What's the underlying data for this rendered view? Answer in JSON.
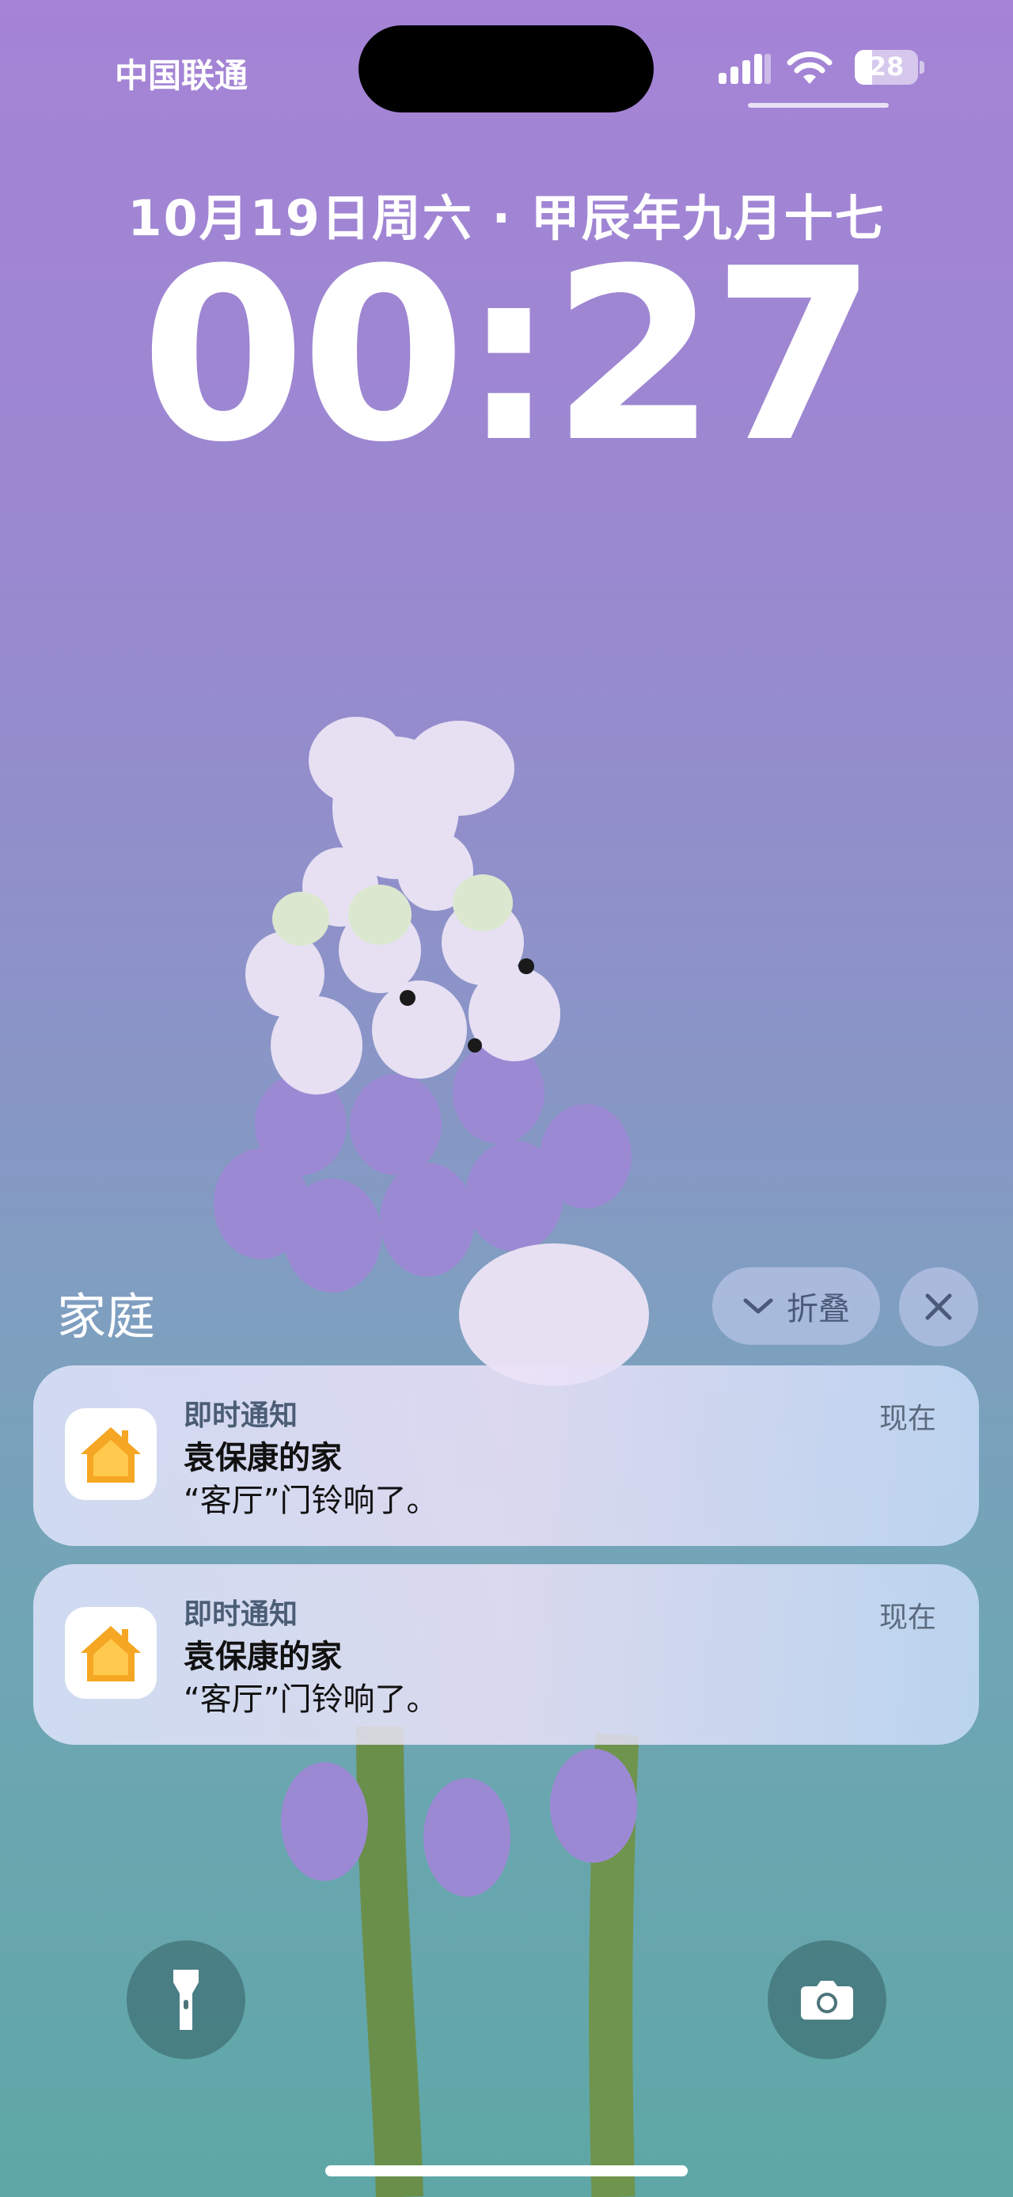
{
  "status_bar": {
    "carrier": "中国联通",
    "battery_level": "28",
    "signal_icon": "cellular-signal-icon",
    "wifi_icon": "wifi-icon"
  },
  "lock_screen": {
    "date": "10月19日周六 · 甲辰年九月十七",
    "time": "00:27"
  },
  "notification_group": {
    "title": "家庭",
    "collapse_label": "折叠",
    "close_icon": "close-icon",
    "notifications": [
      {
        "app_icon": "home-app-icon",
        "app_name": "即时通知",
        "time": "现在",
        "title": "袁保康的家",
        "body": "“客厅”门铃响了。"
      },
      {
        "app_icon": "home-app-icon",
        "app_name": "即时通知",
        "time": "现在",
        "title": "袁保康的家",
        "body": "“客厅”门铃响了。"
      }
    ]
  },
  "quick_actions": {
    "left": "flashlight-icon",
    "right": "camera-icon"
  },
  "colors": {
    "background_top": "#a583d6",
    "background_bottom": "#5ea7a6",
    "home_icon_orange": "#f5a623"
  }
}
